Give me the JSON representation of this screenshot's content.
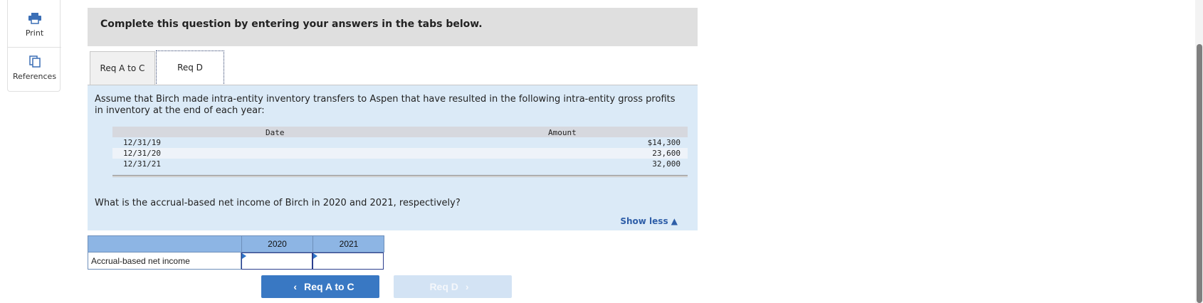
{
  "tools": {
    "print_label": "Print",
    "references_label": "References"
  },
  "header": {
    "instruction": "Complete this question by entering your answers in the tabs below."
  },
  "tabs": [
    {
      "label": "Req A to C",
      "active": false
    },
    {
      "label": "Req D",
      "active": true
    }
  ],
  "panel": {
    "intro": "Assume that Birch made intra-entity inventory transfers to Aspen that have resulted in the following intra-entity gross profits in inventory at the end of each year:",
    "table": {
      "headers": {
        "date": "Date",
        "amount": "Amount"
      },
      "rows": [
        {
          "date": "12/31/19",
          "amount": "$14,300"
        },
        {
          "date": "12/31/20",
          "amount": "23,600"
        },
        {
          "date": "12/31/21",
          "amount": "32,000"
        }
      ]
    },
    "question": "What is the accrual-based net income of Birch in 2020 and 2021, respectively?",
    "show_less": "Show less ▲"
  },
  "answer": {
    "col_2020": "2020",
    "col_2021": "2021",
    "row_label": "Accrual-based net income",
    "value_2020": "",
    "value_2021": ""
  },
  "nav": {
    "prev_label": "Req A to C",
    "prev_chevron": "‹",
    "next_label": "Req D",
    "next_chevron": "›"
  },
  "colors": {
    "panel_bg": "#dbeaf7",
    "header_bg": "#dfdfdf",
    "primary_button": "#3978c3",
    "disabled_button": "#d3e3f4",
    "link": "#2e5ea8"
  }
}
